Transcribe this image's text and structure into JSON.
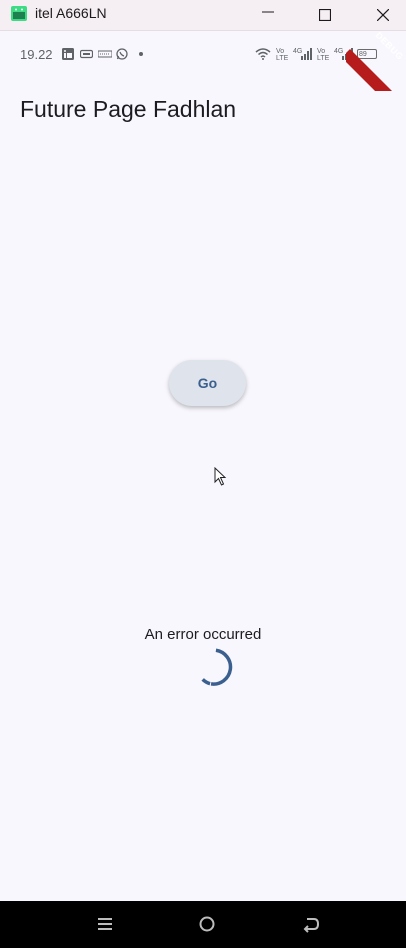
{
  "window": {
    "title": "itel A666LN",
    "buttons": {
      "minimize": "minimize",
      "maximize": "maximize",
      "close": "close"
    }
  },
  "status_bar": {
    "time": "19.22",
    "icons": [
      "linkedin-icon",
      "card-icon",
      "dots-icon",
      "whatsapp-icon",
      "notification-dot-icon",
      "wifi-icon",
      "volte-icon",
      "signal-4g-icon",
      "volte-icon",
      "signal-4g-icon",
      "battery-icon"
    ],
    "volte_label": "Vo LTE",
    "network_label": "4G",
    "battery_level": "89"
  },
  "debug_banner": {
    "label": "DEBUG"
  },
  "app": {
    "title": "Future Page Fadhlan",
    "go_button_label": "Go",
    "status_message": "An error occurred",
    "accent_color": "#3b5f8e"
  },
  "nav_bar": {
    "buttons": [
      "menu-icon",
      "home-icon",
      "back-icon"
    ]
  }
}
